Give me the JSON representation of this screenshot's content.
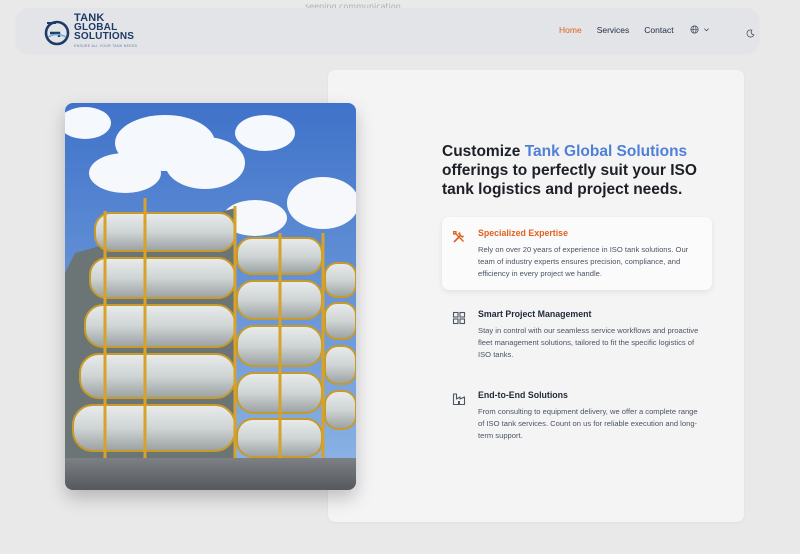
{
  "ghost_text": "seeping communication",
  "brand": {
    "line1": "TANK",
    "line2": "GLOBAL",
    "line3": "SOLUTIONS",
    "tagline": "ENSURE ALL YOUR TANK NEEDS"
  },
  "nav": {
    "items": [
      {
        "label": "Home",
        "active": true
      },
      {
        "label": "Services",
        "active": false
      },
      {
        "label": "Contact",
        "active": false
      }
    ],
    "language_icon": "globe-icon",
    "theme_icon": "moon-icon"
  },
  "hero": {
    "heading_pre": "Customize ",
    "heading_highlight": "Tank Global Solutions",
    "heading_post": " offerings to perfectly suit your ISO tank logistics and project needs.",
    "image_alt": "Stacked ISO tank containers under a blue sky"
  },
  "features": [
    {
      "title": "Specialized Expertise",
      "text": "Rely on over 20 years of experience in ISO tank solutions. Our team of industry experts ensures precision, compliance, and efficiency in every project we handle.",
      "icon": "tools-icon",
      "selected": true
    },
    {
      "title": "Smart Project Management",
      "text": "Stay in control with our seamless service workflows and proactive fleet management solutions, tailored to fit the specific logistics of ISO tanks.",
      "icon": "dashboard-icon",
      "selected": false
    },
    {
      "title": "End-to-End Solutions",
      "text": "From consulting to equipment delivery, we offer a complete range of ISO tank services. Count on us for reliable execution and long-term support.",
      "icon": "factory-icon",
      "selected": false
    }
  ],
  "colors": {
    "accent": "#e0611c",
    "highlight": "#4f80d7",
    "brand_navy": "#1e3a66"
  }
}
